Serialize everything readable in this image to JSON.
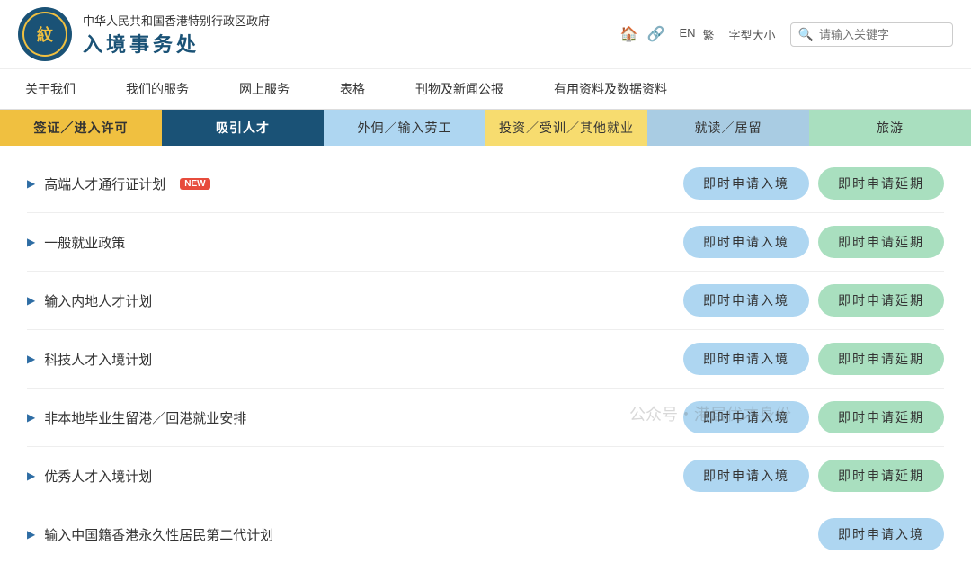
{
  "header": {
    "logo_text": "紋",
    "title_top": "中华人民共和国香港特别行政区政府",
    "title_main": "入境事务处",
    "icons": {
      "home": "🏠",
      "share": "🔗"
    },
    "lang_en": "EN",
    "lang_tc": "繁",
    "font_size_label": "字型大小",
    "search_placeholder": "请输入关键字"
  },
  "main_nav": {
    "items": [
      {
        "label": "关于我们"
      },
      {
        "label": "我们的服务"
      },
      {
        "label": "网上服务"
      },
      {
        "label": "表格"
      },
      {
        "label": "刊物及新闻公报"
      },
      {
        "label": "有用资料及数据资料"
      }
    ]
  },
  "sub_nav": {
    "items": [
      {
        "label": "签证／进入许可",
        "style": "yellow"
      },
      {
        "label": "吸引人才",
        "style": "active"
      },
      {
        "label": "外佣／输入劳工",
        "style": "light-blue"
      },
      {
        "label": "投资／受训／其他就业",
        "style": "gold"
      },
      {
        "label": "就读／居留",
        "style": "teal"
      },
      {
        "label": "旅游",
        "style": "green2"
      }
    ]
  },
  "list": {
    "items": [
      {
        "label": "高端人才通行证计划",
        "is_new": true,
        "btn1": "即时申请入境",
        "btn2": "即时申请延期"
      },
      {
        "label": "一般就业政策",
        "is_new": false,
        "btn1": "即时申请入境",
        "btn2": "即时申请延期"
      },
      {
        "label": "输入内地人才计划",
        "is_new": false,
        "btn1": "即时申请入境",
        "btn2": "即时申请延期"
      },
      {
        "label": "科技人才入境计划",
        "is_new": false,
        "btn1": "即时申请入境",
        "btn2": "即时申请延期"
      },
      {
        "label": "非本地毕业生留港／回港就业安排",
        "is_new": false,
        "btn1": "即时申请入境",
        "btn2": "即时申请延期"
      },
      {
        "label": "优秀人才入境计划",
        "is_new": false,
        "btn1": "即时申请入境",
        "btn2": "即时申请延期"
      },
      {
        "label": "输入中国籍香港永久性居民第二代计划",
        "is_new": false,
        "btn1": "即时申请入境",
        "btn2": ""
      }
    ],
    "new_label": "NEW",
    "arrow": "▶"
  },
  "watermark": {
    "text": "公众号・港居优才身份"
  }
}
